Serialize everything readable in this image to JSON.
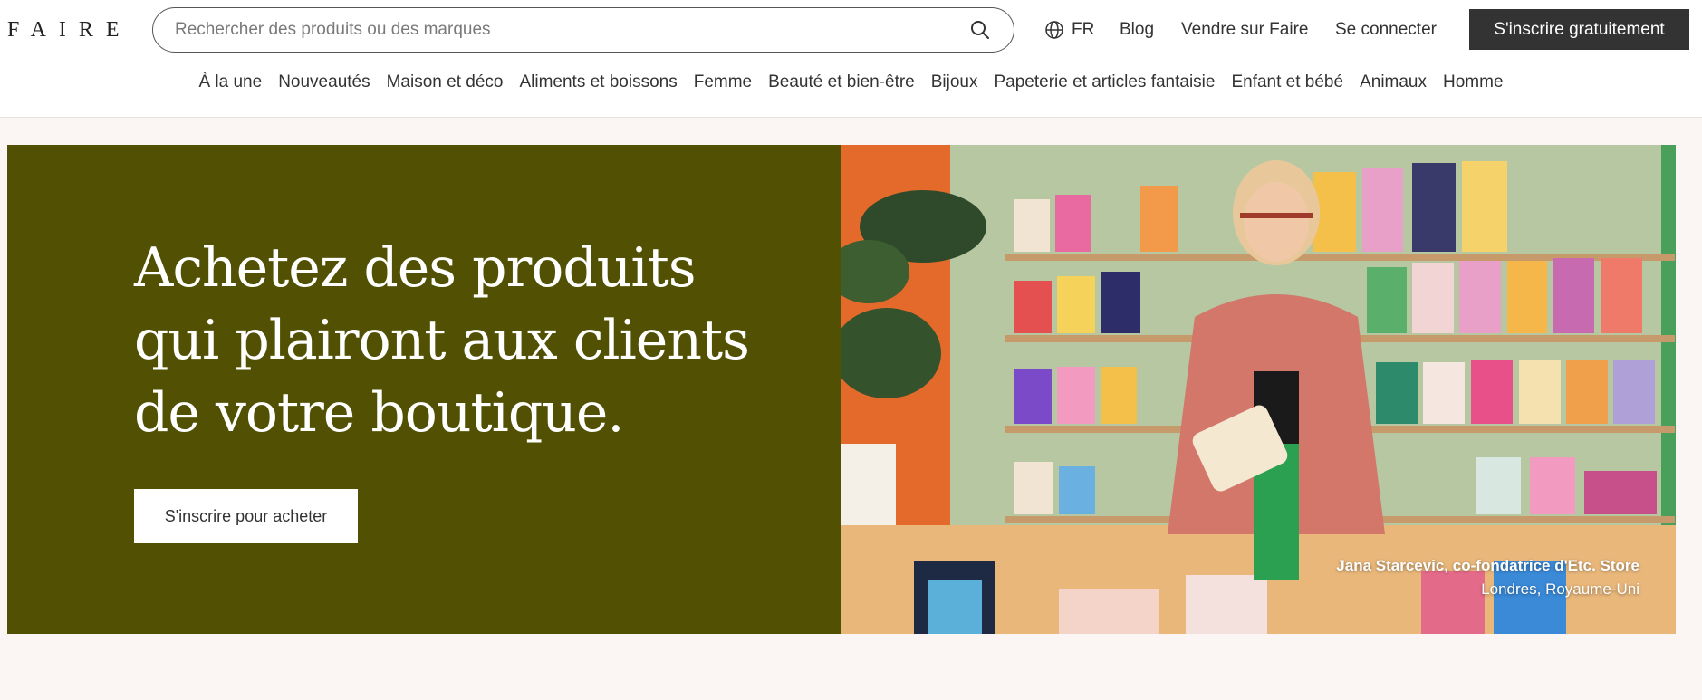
{
  "header": {
    "logo": "FAIRE",
    "search_placeholder": "Rechercher des produits ou des marques",
    "language": "FR",
    "blog": "Blog",
    "sell": "Vendre sur Faire",
    "login": "Se connecter",
    "signup": "S'inscrire gratuitement"
  },
  "categories": [
    "À la une",
    "Nouveautés",
    "Maison et déco",
    "Aliments et boissons",
    "Femme",
    "Beauté et bien-être",
    "Bijoux",
    "Papeterie et articles fantaisie",
    "Enfant et bébé",
    "Animaux",
    "Homme"
  ],
  "hero": {
    "headline": "Achetez des produits qui plairont aux clients de votre boutique.",
    "cta": "S'inscrire pour acheter",
    "caption_name": "Jana Starcevic, co-fondatrice d'Etc. Store",
    "caption_location": "Londres, Royaume-Uni",
    "bg_color": "#525103"
  },
  "colors": {
    "dark_button": "#333333",
    "page_bg": "#fbf6f3"
  }
}
